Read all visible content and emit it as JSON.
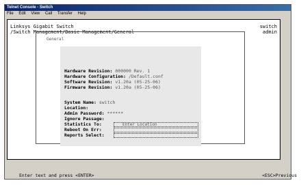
{
  "window": {
    "title": "Telnet Console - Switch"
  },
  "menubar": {
    "items": [
      "File",
      "Edit",
      "View",
      "Call",
      "Transfer",
      "Help"
    ]
  },
  "header": {
    "left_line1": "Linksys Gigabit Switch",
    "left_line2": "/Switch Management/Basic Management/General",
    "right_line1": "switch",
    "right_line2": "admin"
  },
  "panel": {
    "tab_title": "General"
  },
  "info": [
    {
      "label": "Hardware Revision:",
      "value": "000000 Rev. 1"
    },
    {
      "label": "Hardware Configuration:",
      "value": "/Default.conf"
    },
    {
      "label": "Software Revision:",
      "value": "v1.20a (05-25-06)"
    },
    {
      "label": "Firmware Revision:",
      "value": "v1.20a (05-25-06)"
    }
  ],
  "form": {
    "system_name": {
      "label": "System Name:",
      "value": "switch"
    },
    "location": {
      "label": "Location:"
    },
    "admin_password": {
      "label": "Admin Password:",
      "value": "******"
    },
    "ignore_passage": {
      "label": "Ignore Passage:"
    },
    "statistics_to": {
      "label": "Statistics To:",
      "placeholder": "Enter Location"
    },
    "reboot_on_err": {
      "label": "Reboot On Err:"
    },
    "reports_select": {
      "label": "Reports Select:"
    }
  },
  "footer": {
    "left": "Enter text and press <ENTER>",
    "right": "<ESC>Previous"
  }
}
